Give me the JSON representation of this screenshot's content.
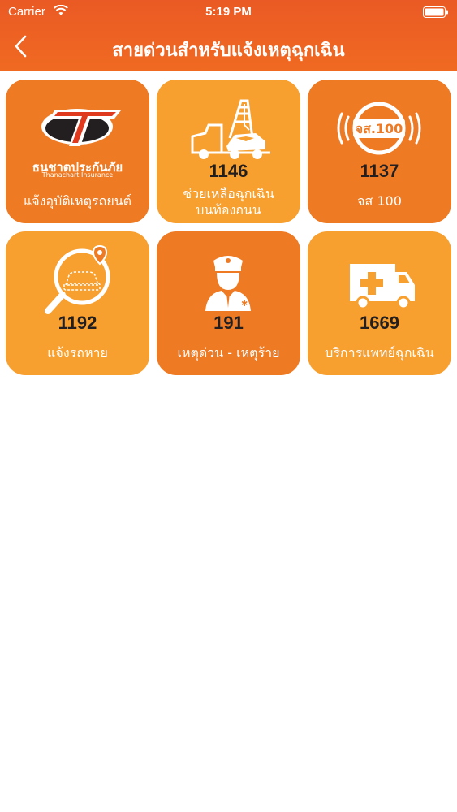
{
  "status_bar": {
    "carrier": "Carrier",
    "time": "5:19 PM"
  },
  "nav": {
    "back_icon": "chevron-left-icon",
    "title": "สายด่วนสำหรับแจ้งเหตุฉุกเฉิน"
  },
  "colors": {
    "header": "#ea5a24",
    "tile_dark": "#ee7b24",
    "tile_light": "#f7a030",
    "number_text": "#231f20"
  },
  "tiles": [
    {
      "icon": "thanachart-insurance-logo",
      "number": "",
      "label": "แจ้งอุบัติเหตุรถยนต์",
      "logo_name_th": "ธนชาตประกันภัย",
      "logo_name_en": "Thanachart Insurance"
    },
    {
      "icon": "tow-truck-icon",
      "number": "1146",
      "label_line1": "ช่วยเหลือฉุกเฉิน",
      "label_line2": "บนท้องถนน"
    },
    {
      "icon": "radio-jor-sor-100-icon",
      "number": "1137",
      "label": "จส 100",
      "icon_text": "จส.100"
    },
    {
      "icon": "car-search-icon",
      "number": "1192",
      "label": "แจ้งรถหาย"
    },
    {
      "icon": "police-officer-icon",
      "number": "191",
      "label": "เหตุด่วน - เหตุร้าย"
    },
    {
      "icon": "ambulance-icon",
      "number": "1669",
      "label": "บริการแพทย์ฉุกเฉิน"
    }
  ]
}
